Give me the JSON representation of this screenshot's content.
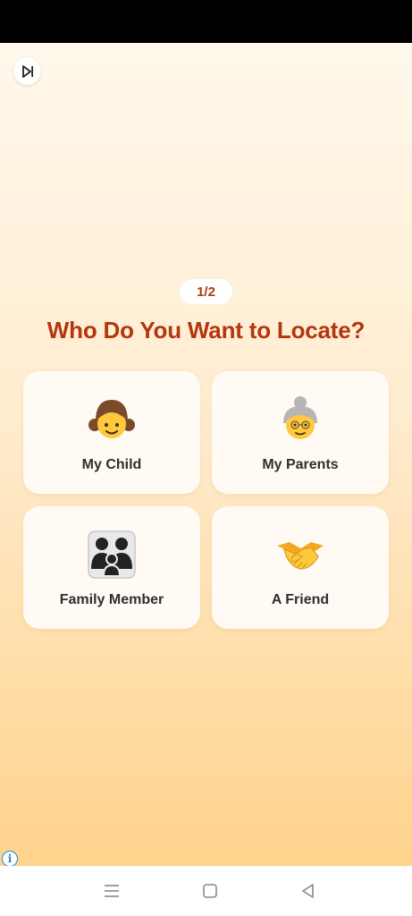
{
  "header": {
    "skip_icon": "skip-next-icon"
  },
  "progress": {
    "step_text": "1/2",
    "current": 1,
    "total": 2
  },
  "question": "Who Do You Want to Locate?",
  "options": [
    {
      "label": "My Child",
      "icon": "girl-emoji-icon"
    },
    {
      "label": "My Parents",
      "icon": "old-woman-emoji-icon"
    },
    {
      "label": "Family Member",
      "icon": "family-emoji-icon"
    },
    {
      "label": "A Friend",
      "icon": "handshake-emoji-icon"
    }
  ],
  "ad": {
    "icon": "ad-info-icon"
  },
  "navigation": {
    "icons": [
      "menu-icon",
      "home-square-icon",
      "back-triangle-icon"
    ]
  },
  "colors": {
    "accent": "#b3360d",
    "card": "#fffaf4",
    "label": "#2f2f2f"
  }
}
